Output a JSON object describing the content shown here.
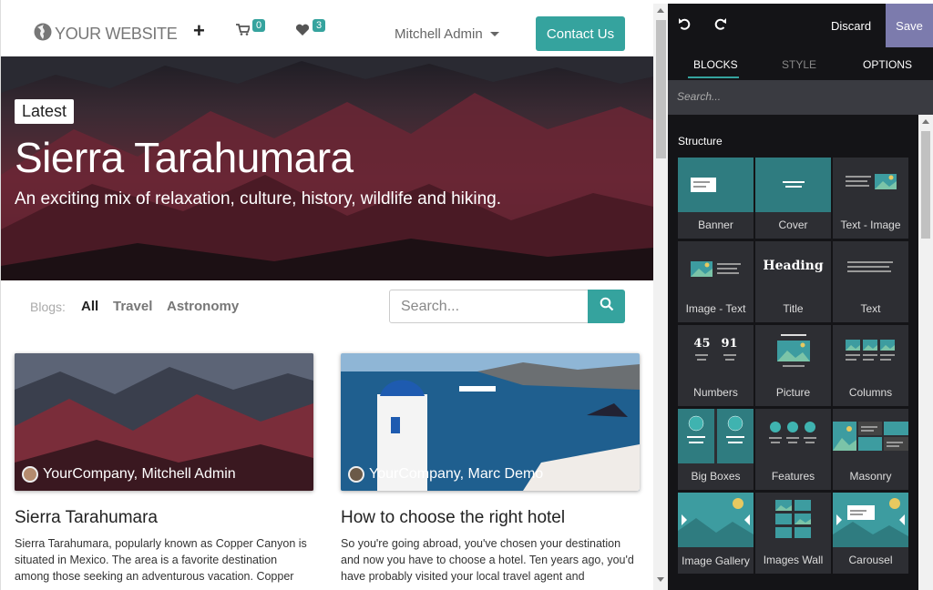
{
  "site": {
    "brand": "YOUR WEBSITE",
    "cart_count": "0",
    "wishlist_count": "3",
    "user_name": "Mitchell Admin",
    "contact_label": "Contact Us"
  },
  "hero": {
    "badge": "Latest",
    "title": "Sierra Tarahumara",
    "subtitle": "An exciting mix of relaxation, culture, history, wildlife and hiking."
  },
  "blogs": {
    "label": "Blogs:",
    "tabs": [
      {
        "label": "All"
      },
      {
        "label": "Travel"
      },
      {
        "label": "Astronomy"
      }
    ],
    "search_placeholder": "Search..."
  },
  "posts": [
    {
      "author": "YourCompany, Mitchell Admin",
      "title": "Sierra Tarahumara",
      "excerpt": "Sierra Tarahumara, popularly known as Copper Canyon is situated in Mexico. The area is a favorite destination among those seeking an adventurous vacation. Copper"
    },
    {
      "author": "YourCompany, Marc Demo",
      "title": "How to choose the right hotel",
      "excerpt": "So you're going abroad, you've chosen your destination and now you have to choose a hotel. Ten years ago, you'd have probably visited your local travel agent and"
    }
  ],
  "editor": {
    "discard_label": "Discard",
    "save_label": "Save",
    "tabs": [
      {
        "label": "BLOCKS"
      },
      {
        "label": "STYLE"
      },
      {
        "label": "OPTIONS"
      }
    ],
    "search_placeholder": "Search...",
    "section_title": "Structure",
    "snippets": [
      {
        "label": "Banner",
        "icon": "banner-icon"
      },
      {
        "label": "Cover",
        "icon": "cover-icon"
      },
      {
        "label": "Text - Image",
        "icon": "text-image-icon"
      },
      {
        "label": "Image - Text",
        "icon": "image-text-icon"
      },
      {
        "label": "Title",
        "icon": "title-icon",
        "glyph": "Heading"
      },
      {
        "label": "Text",
        "icon": "text-icon"
      },
      {
        "label": "Numbers",
        "icon": "numbers-icon",
        "glyph_a": "45",
        "glyph_b": "91"
      },
      {
        "label": "Picture",
        "icon": "picture-icon"
      },
      {
        "label": "Columns",
        "icon": "columns-icon"
      },
      {
        "label": "Big Boxes",
        "icon": "big-boxes-icon"
      },
      {
        "label": "Features",
        "icon": "features-icon"
      },
      {
        "label": "Masonry",
        "icon": "masonry-icon"
      },
      {
        "label": "Image Gallery",
        "icon": "image-gallery-icon"
      },
      {
        "label": "Images Wall",
        "icon": "images-wall-icon"
      },
      {
        "label": "Carousel",
        "icon": "carousel-icon"
      }
    ]
  },
  "colors": {
    "accent": "#35a39e",
    "save": "#7c7bad",
    "panel_dark": "#141417",
    "snippet_bg": "#2d2e33"
  }
}
